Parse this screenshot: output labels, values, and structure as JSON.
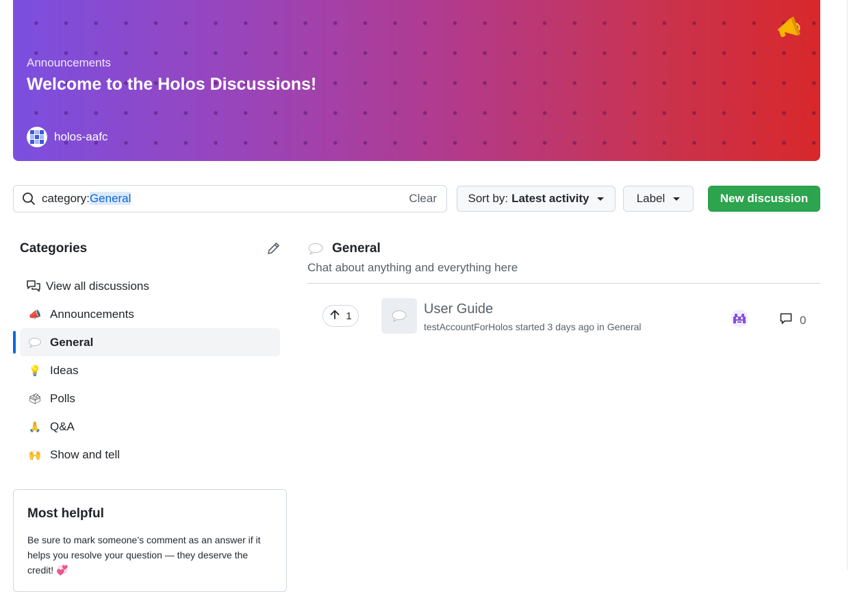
{
  "banner": {
    "subtitle": "Announcements",
    "title": "Welcome to the Holos Discussions!",
    "author": "holos-aafc"
  },
  "search": {
    "prefix": "category:",
    "highlight": "General",
    "clear_label": "Clear"
  },
  "toolbar": {
    "sort_prefix": "Sort by:",
    "sort_value": "Latest activity",
    "label_button": "Label",
    "new_discussion": "New discussion"
  },
  "sidebar": {
    "heading": "Categories",
    "items": [
      {
        "label": "View all discussions",
        "icon": "discussions-icon",
        "emoji": ""
      },
      {
        "label": "Announcements",
        "icon": "megaphone-icon",
        "emoji": "📣"
      },
      {
        "label": "General",
        "icon": "speech-balloon-icon",
        "emoji": "💬",
        "active": true
      },
      {
        "label": "Ideas",
        "icon": "lightbulb-icon",
        "emoji": "💡"
      },
      {
        "label": "Polls",
        "icon": "ballot-box-icon",
        "emoji": "🗳"
      },
      {
        "label": "Q&A",
        "icon": "person-praying-icon",
        "emoji": "🙏"
      },
      {
        "label": "Show and tell",
        "icon": "raised-hands-icon",
        "emoji": "🙌"
      }
    ]
  },
  "helpful": {
    "title": "Most helpful",
    "text": "Be sure to mark someone’s comment as an answer if it helps you resolve your question — they deserve the credit! 💞"
  },
  "category": {
    "name": "General",
    "description": "Chat about anything and everything here"
  },
  "discussions": [
    {
      "title": "User Guide",
      "upvotes": "1",
      "author": "testAccountForHolos",
      "meta": "testAccountForHolos started 3 days ago in General",
      "comments": "0"
    }
  ],
  "colors": {
    "accent": "#0969da",
    "primary_button": "#2da44e",
    "banner_start": "#7b4fe0",
    "banner_end": "#d8282b"
  }
}
